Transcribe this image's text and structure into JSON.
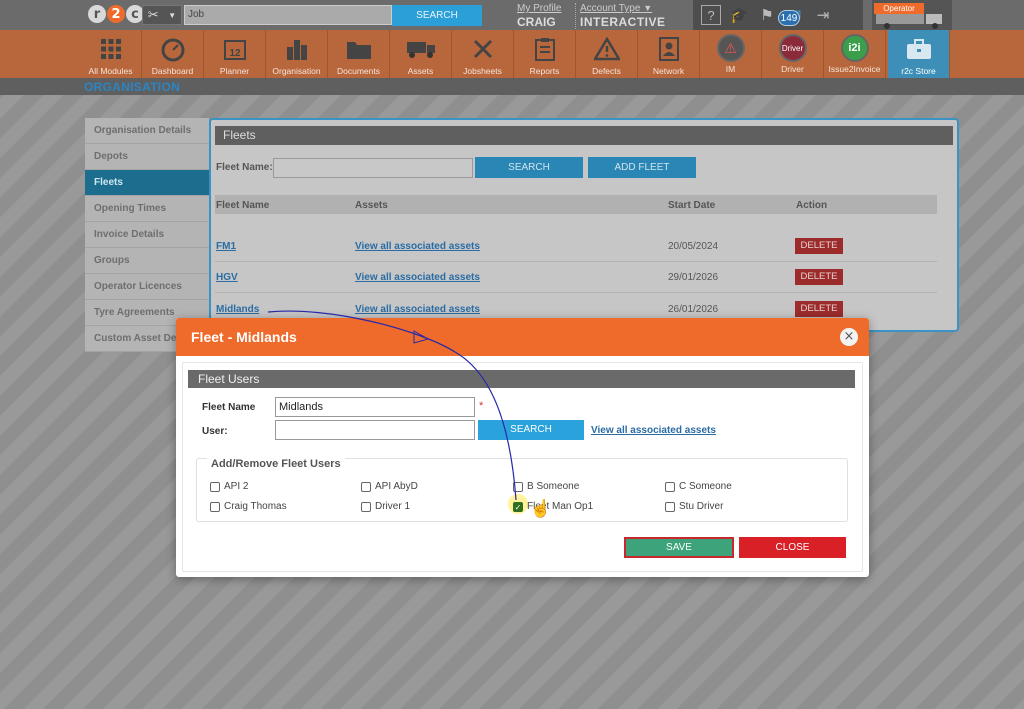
{
  "topbar": {
    "logo": {
      "r": "r",
      "two": "2",
      "c": "c"
    },
    "job_search": {
      "placeholder": "Job",
      "button": "SEARCH"
    },
    "profile": {
      "link": "My Profile",
      "name": "CRAIG"
    },
    "account": {
      "link": "Account Type",
      "value": "INTERACTIVE"
    },
    "icons": [
      "help-icon",
      "graduation-cap-icon",
      "notifications-icon",
      "mail-icon",
      "logout-icon"
    ],
    "notification_count": "149",
    "operator_label": "Operator"
  },
  "modules": [
    {
      "label": "All Modules",
      "icon": "grid-icon"
    },
    {
      "label": "Dashboard",
      "icon": "speedometer-icon"
    },
    {
      "label": "Planner",
      "icon": "calendar-icon"
    },
    {
      "label": "Organisation",
      "icon": "buildings-icon"
    },
    {
      "label": "Documents",
      "icon": "folder-icon"
    },
    {
      "label": "Assets",
      "icon": "truck-icon"
    },
    {
      "label": "Jobsheets",
      "icon": "tools-icon"
    },
    {
      "label": "Reports",
      "icon": "clipboard-icon"
    },
    {
      "label": "Defects",
      "icon": "warning-icon"
    },
    {
      "label": "Network",
      "icon": "contact-card-icon"
    },
    {
      "label": "IM",
      "icon": "im-icon"
    },
    {
      "label": "Driver",
      "icon": "driver-icon"
    },
    {
      "label": "Issue2Invoice",
      "icon": "i2i-icon"
    },
    {
      "label": "r2c Store",
      "icon": "briefcase-icon"
    }
  ],
  "calendar_number": "12",
  "driver_badge": "Driver",
  "i2i_badge": "i2i",
  "section_title": "ORGANISATION",
  "sidebar": {
    "items": [
      {
        "label": "Organisation Details"
      },
      {
        "label": "Depots"
      },
      {
        "label": "Fleets"
      },
      {
        "label": "Opening Times"
      },
      {
        "label": "Invoice Details"
      },
      {
        "label": "Groups"
      },
      {
        "label": "Operator Licences"
      },
      {
        "label": "Tyre Agreements"
      },
      {
        "label": "Custom Asset Details"
      }
    ],
    "active": "Fleets"
  },
  "fleets": {
    "title": "Fleets",
    "filter_label": "Fleet Name:",
    "search_button": "SEARCH",
    "add_button": "ADD FLEET",
    "columns": [
      "Fleet Name",
      "Assets",
      "Start Date",
      "Action"
    ],
    "rows": [
      {
        "name": "FM1",
        "assets": "View all associated assets",
        "start_date": "20/05/2024",
        "action": "DELETE"
      },
      {
        "name": "HGV",
        "assets": "View all associated assets",
        "start_date": "29/01/2026",
        "action": "DELETE"
      },
      {
        "name": "Midlands",
        "assets": "View all associated assets",
        "start_date": "26/01/2026",
        "action": "DELETE"
      }
    ]
  },
  "modal": {
    "title": "Fleet - Midlands",
    "section": "Fleet Users",
    "fleet_name_label": "Fleet Name",
    "fleet_name_value": "Midlands",
    "required_mark": "*",
    "user_label": "User:",
    "user_value": "",
    "search_button": "SEARCH",
    "assets_link": "View all associated assets",
    "users_legend": "Add/Remove Fleet Users",
    "users": [
      {
        "name": "API 2",
        "checked": false
      },
      {
        "name": "API AbyD",
        "checked": false
      },
      {
        "name": "B Someone",
        "checked": false
      },
      {
        "name": "C Someone",
        "checked": false
      },
      {
        "name": "Craig Thomas",
        "checked": false
      },
      {
        "name": "Driver 1",
        "checked": false
      },
      {
        "name": "Fleet Man Op1",
        "checked": true
      },
      {
        "name": "Stu Driver",
        "checked": false
      }
    ],
    "save_button": "SAVE",
    "close_button": "CLOSE"
  },
  "colors": {
    "accent_orange": "#ef6b2c",
    "accent_blue": "#2aa3dd",
    "delete_red": "#9c2c2c",
    "save_green": "#3da37a",
    "close_red": "#d92027"
  }
}
